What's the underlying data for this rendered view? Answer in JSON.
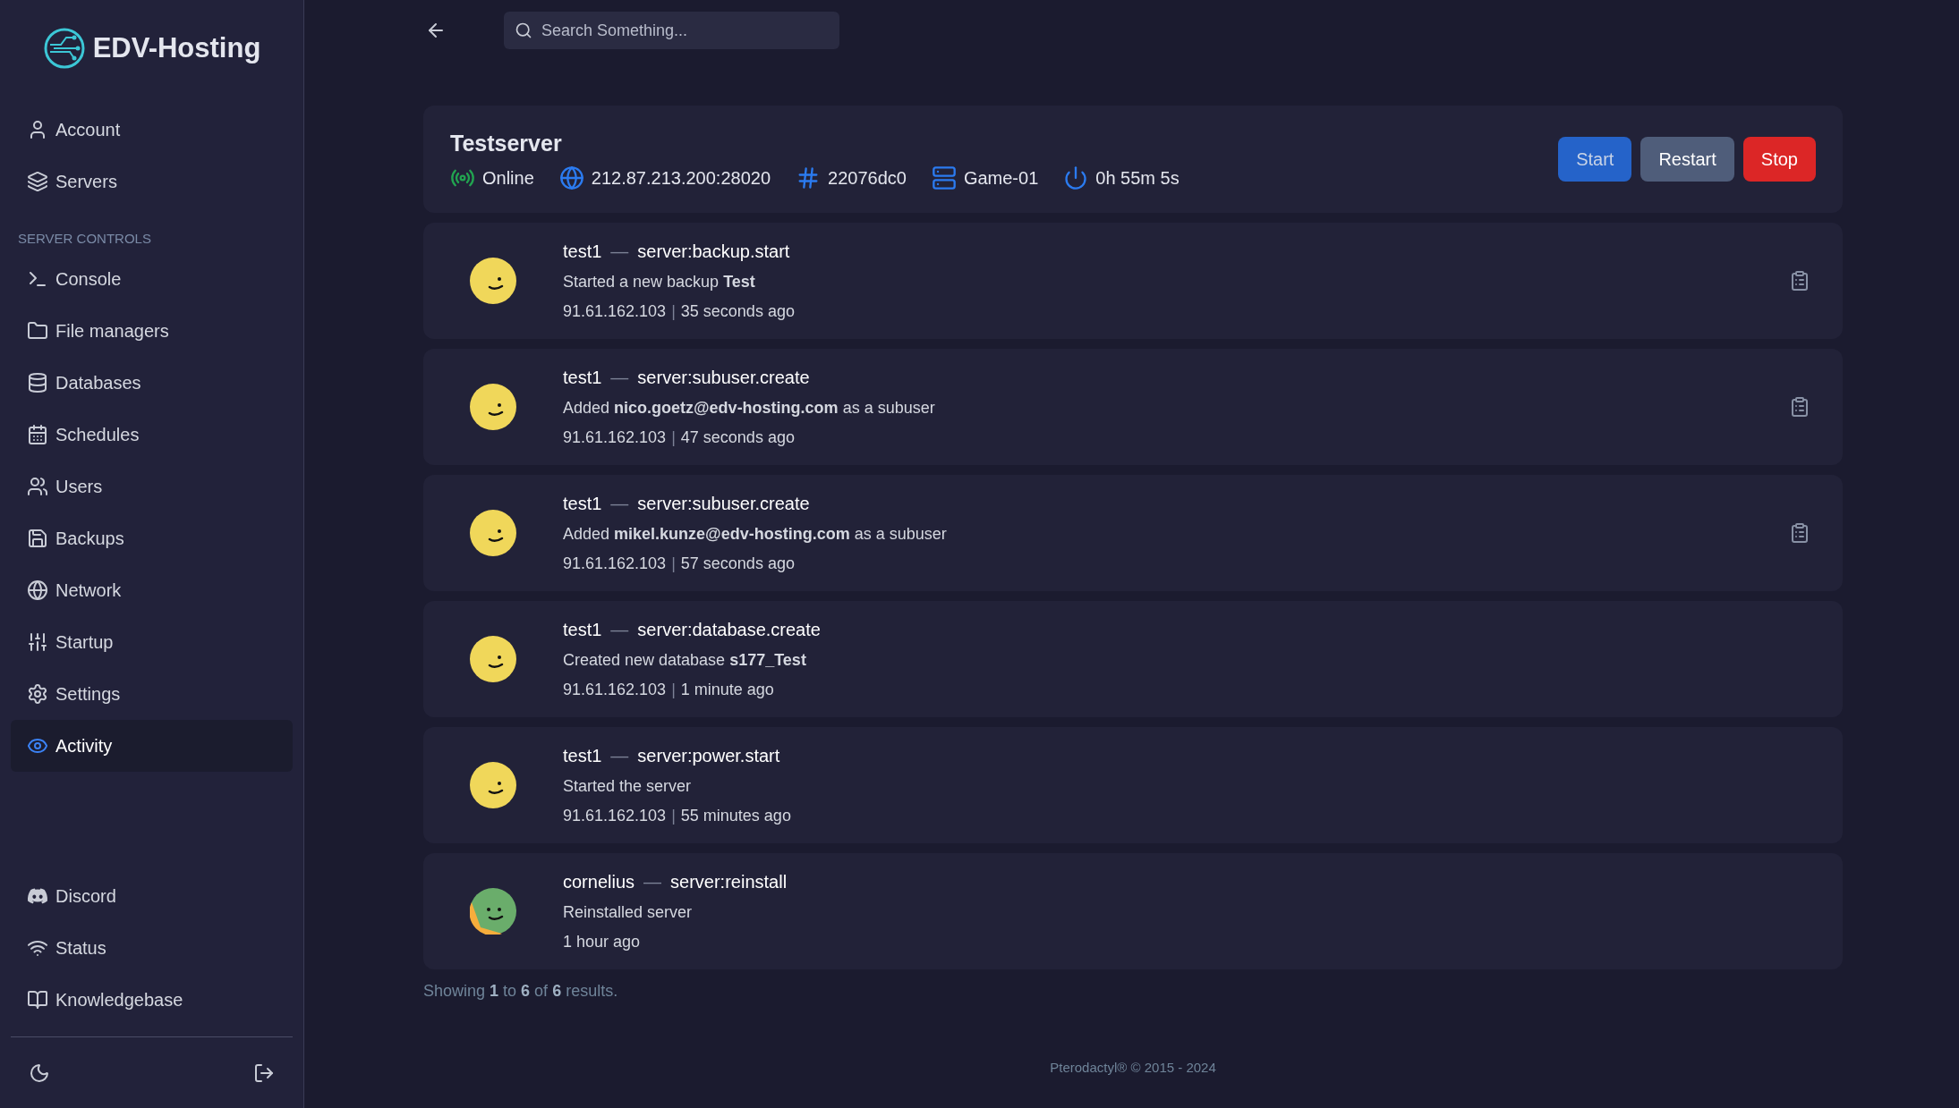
{
  "brand": {
    "name": "EDV-Hosting"
  },
  "nav_top": [
    {
      "label": "Account",
      "selected": false
    },
    {
      "label": "Servers",
      "selected": false
    }
  ],
  "section_label": "SERVER CONTROLS",
  "nav_server": [
    {
      "label": "Console",
      "selected": false
    },
    {
      "label": "File managers",
      "selected": false
    },
    {
      "label": "Databases",
      "selected": false
    },
    {
      "label": "Schedules",
      "selected": false
    },
    {
      "label": "Users",
      "selected": false
    },
    {
      "label": "Backups",
      "selected": false
    },
    {
      "label": "Network",
      "selected": false
    },
    {
      "label": "Startup",
      "selected": false
    },
    {
      "label": "Settings",
      "selected": false
    },
    {
      "label": "Activity",
      "selected": true
    }
  ],
  "nav_bottom": [
    {
      "label": "Discord",
      "selected": false
    },
    {
      "label": "Status",
      "selected": false
    },
    {
      "label": "Knowledgebase",
      "selected": false
    }
  ],
  "search": {
    "placeholder": "Search Something..."
  },
  "server": {
    "name": "Testserver",
    "stats": [
      "Online",
      "212.87.213.200:28020",
      "22076dc0",
      "Game-01",
      "0h 55m 5s"
    ],
    "buttons": [
      {
        "kind": "start",
        "label": "Start"
      },
      {
        "kind": "restart",
        "label": "Restart"
      },
      {
        "kind": "stop",
        "label": "Stop"
      }
    ]
  },
  "events": [
    {
      "actor": "test1",
      "dash": "—",
      "event": "server:backup.start",
      "description": "Started a new backup **Test**",
      "ip": "91.61.162.103",
      "sep": "|",
      "time": "35 seconds ago",
      "color": "#f0d75a",
      "has_metadata": true
    },
    {
      "actor": "test1",
      "dash": "—",
      "event": "server:subuser.create",
      "description": "Added **nico.goetz@edv-hosting.com** as a subuser",
      "ip": "91.61.162.103",
      "sep": "|",
      "time": "47 seconds ago",
      "color": "#f0d75a",
      "has_metadata": true
    },
    {
      "actor": "test1",
      "dash": "—",
      "event": "server:subuser.create",
      "description": "Added **mikel.kunze@edv-hosting.com** as a subuser",
      "ip": "91.61.162.103",
      "sep": "|",
      "time": "57 seconds ago",
      "color": "#f0d75a",
      "has_metadata": true
    },
    {
      "actor": "test1",
      "dash": "—",
      "event": "server:database.create",
      "description": "Created new database **s177_Test**",
      "ip": "91.61.162.103",
      "sep": "|",
      "time": "1 minute ago",
      "color": "#f0d75a",
      "has_metadata": false
    },
    {
      "actor": "test1",
      "dash": "—",
      "event": "server:power.start",
      "description": "Started the server",
      "ip": "91.61.162.103",
      "sep": "|",
      "time": "55 minutes ago",
      "color": "#f0d75a",
      "has_metadata": false
    },
    {
      "actor": "cornelius",
      "dash": "—",
      "event": "server:reinstall",
      "description": "Reinstalled server",
      "time": "1 hour ago",
      "color": "#6aad6b",
      "has_metadata": false
    }
  ],
  "pagination": "Showing **1** to **6** of **6** results.",
  "footer": "Pterodactyl® © 2015 - 2024"
}
